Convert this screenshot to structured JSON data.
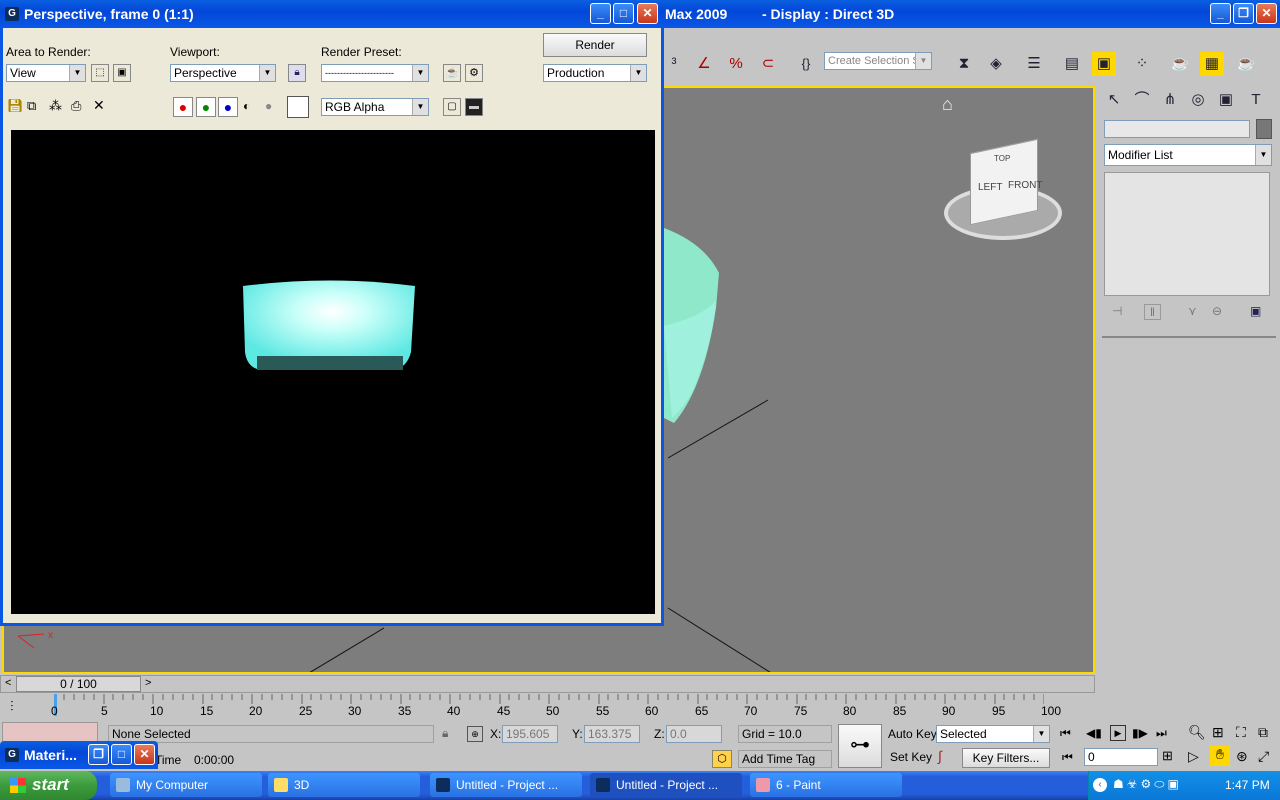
{
  "max_title": {
    "app": "Max  2009",
    "display": "- Display : Direct 3D"
  },
  "main_toolbar": {
    "selection_set_placeholder": "Create Selection Set"
  },
  "command_panel": {
    "modifier_list": "Modifier List"
  },
  "render_window": {
    "title": "Perspective, frame 0 (1:1)",
    "area_label": "Area to Render:",
    "area_value": "View",
    "viewport_label": "Viewport:",
    "viewport_value": "Perspective",
    "preset_label": "Render Preset:",
    "preset_value": "-----------------------",
    "render_button": "Render",
    "production_value": "Production",
    "channel_value": "RGB Alpha"
  },
  "viewcube": {
    "top": "TOP",
    "left": "LEFT",
    "front": "FRONT"
  },
  "timeline": {
    "slider_value": "0 / 100",
    "ticks": [
      "0",
      "5",
      "10",
      "15",
      "20",
      "25",
      "30",
      "35",
      "40",
      "45",
      "50",
      "55",
      "60",
      "65",
      "70",
      "75",
      "80",
      "85",
      "90",
      "95",
      "100"
    ]
  },
  "status": {
    "selection": "None Selected",
    "x_label": "X:",
    "x_value": "195.605",
    "y_label": "Y:",
    "y_value": "163.375",
    "z_label": "Z:",
    "z_value": "0.0",
    "grid": "Grid = 10.0",
    "time_label": "Time",
    "time_value": "0:00:00",
    "add_time_tag": "Add Time Tag",
    "auto_key": "Auto Key",
    "set_key": "Set Key",
    "selected_value": "Selected",
    "key_filters": "Key Filters...",
    "frame_value": "0"
  },
  "material_editor": {
    "title": "Materi..."
  },
  "taskbar": {
    "start": "start",
    "items": [
      "My Computer",
      "3D",
      "Untitled      - Project ...",
      "Untitled      - Project ...",
      "6 - Paint"
    ],
    "clock": "1:47 PM"
  },
  "colors": {
    "accent_yellow": "#ffd800",
    "xp_blue": "#0a5fe0",
    "bowl_cyan": "#7ff5f0"
  }
}
